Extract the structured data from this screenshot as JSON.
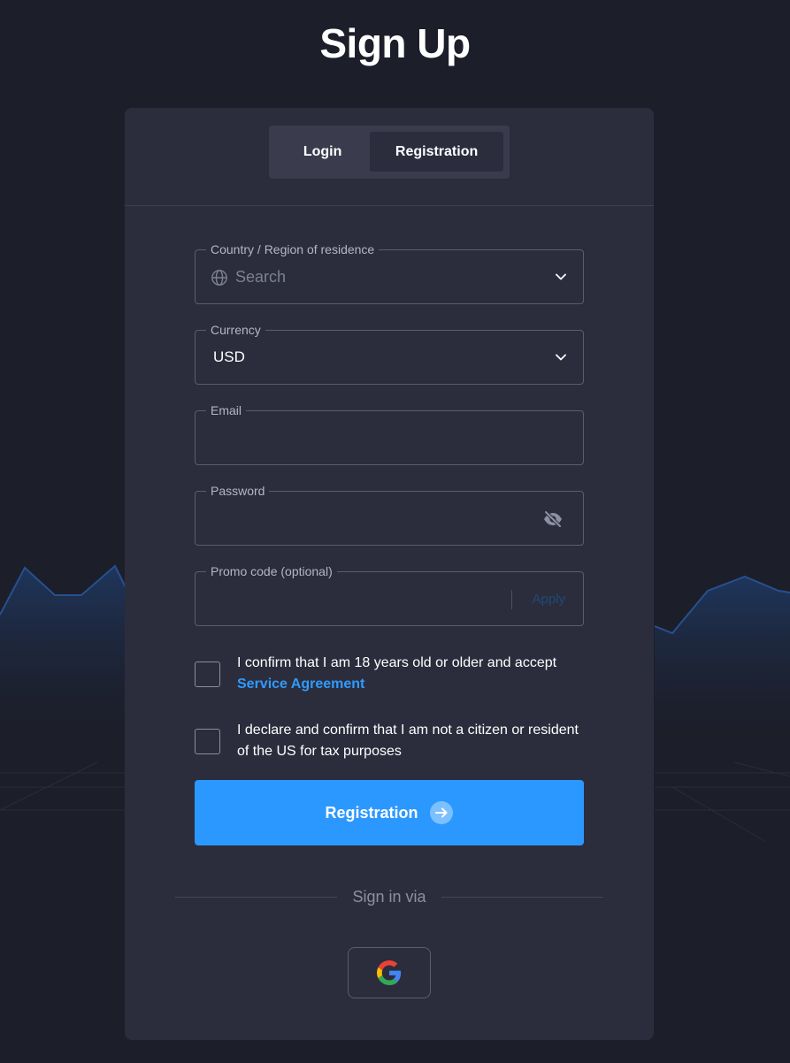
{
  "page": {
    "title": "Sign Up"
  },
  "tabs": [
    {
      "label": "Login",
      "active": false
    },
    {
      "label": "Registration",
      "active": true
    }
  ],
  "form": {
    "country": {
      "label": "Country / Region of residence",
      "placeholder": "Search",
      "value": ""
    },
    "currency": {
      "label": "Currency",
      "value": "USD"
    },
    "email": {
      "label": "Email",
      "value": ""
    },
    "password": {
      "label": "Password",
      "value": ""
    },
    "promo": {
      "label": "Promo code (optional)",
      "value": "",
      "apply_label": "Apply"
    }
  },
  "checks": {
    "age": {
      "text": "I confirm that I am 18 years old or older and accept",
      "link": "Service Agreement",
      "checked": false
    },
    "tax": {
      "text": "I declare and confirm that I am not a citizen or resident of the US for tax purposes",
      "checked": false
    }
  },
  "actions": {
    "register_label": "Registration",
    "sign_in_via": "Sign in via"
  },
  "icons": {
    "country": "globe-icon",
    "dropdown": "chevron-down-icon",
    "password_toggle": "eye-off-icon",
    "register": "arrow-right-icon",
    "social": "google-icon"
  },
  "colors": {
    "background": "#1c1e29",
    "card": "#2b2d3d",
    "accent": "#2b98ff",
    "link": "#2f9bff"
  }
}
